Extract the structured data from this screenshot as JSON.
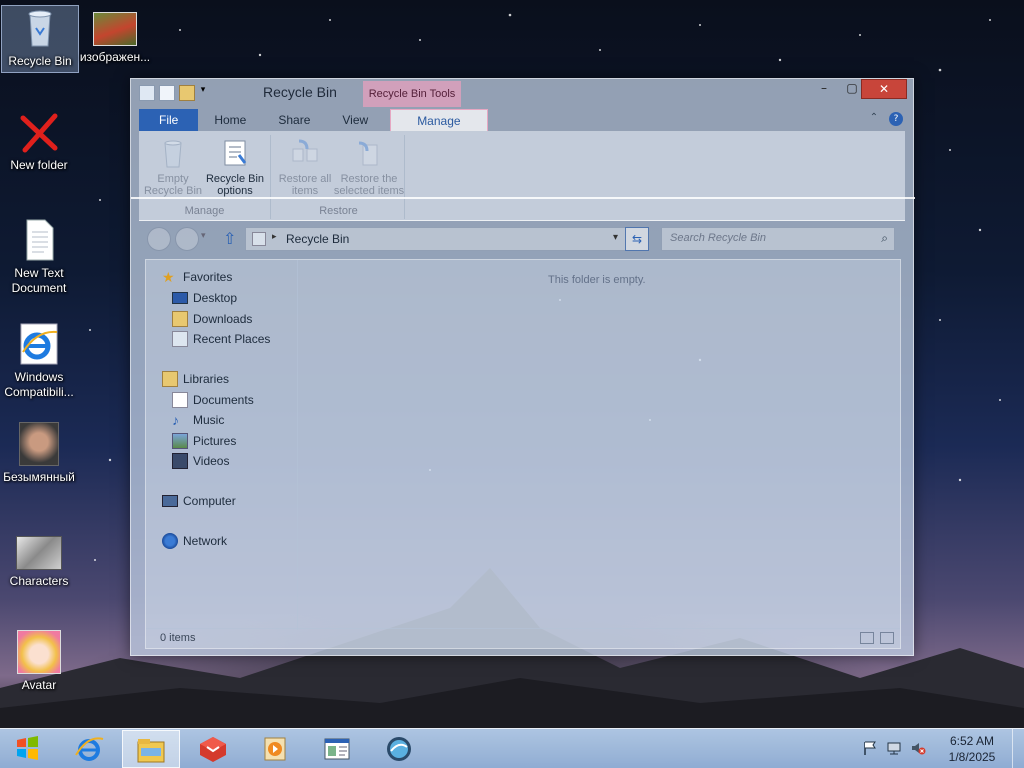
{
  "desktop": {
    "icons": [
      {
        "label": "Recycle Bin",
        "icon": "recycle-bin-icon"
      },
      {
        "label": "изображен...",
        "icon": "image-thumbnail-icon"
      },
      {
        "label": "New folder",
        "icon": "red-x-icon"
      },
      {
        "label": "New Text Document",
        "icon": "text-document-icon"
      },
      {
        "label": "Windows Compatibili...",
        "icon": "internet-explorer-icon"
      },
      {
        "label": "Безымянный",
        "icon": "photo-thumbnail-icon"
      },
      {
        "label": "Characters",
        "icon": "characters-image-icon"
      },
      {
        "label": "Avatar",
        "icon": "avatar-image-icon"
      }
    ]
  },
  "window": {
    "title": "Recycle Bin",
    "contextual_tab_header": "Recycle Bin Tools",
    "tabs": [
      "File",
      "Home",
      "Share",
      "View",
      "Manage"
    ],
    "ribbon": {
      "groups": [
        {
          "label": "Manage",
          "buttons": [
            "Empty Recycle Bin",
            "Recycle Bin options"
          ]
        },
        {
          "label": "Restore",
          "buttons": [
            "Restore all items",
            "Restore the selected items"
          ]
        }
      ]
    },
    "address": {
      "path": "Recycle Bin"
    },
    "search": {
      "placeholder": "Search Recycle Bin"
    },
    "nav": {
      "favorites": "Favorites",
      "desktop": "Desktop",
      "downloads": "Downloads",
      "recent_places": "Recent Places",
      "libraries": "Libraries",
      "documents": "Documents",
      "music": "Music",
      "pictures": "Pictures",
      "videos": "Videos",
      "computer": "Computer",
      "network": "Network"
    },
    "empty_message": "This folder is empty.",
    "status": "0 items"
  },
  "taskbar": {
    "items": [
      "internet-explorer-icon",
      "file-explorer-icon",
      "red-cube-app-icon",
      "media-player-icon",
      "window-app-icon",
      "globe-app-icon"
    ],
    "clock": {
      "time": "6:52 AM",
      "date": "1/8/2025"
    }
  }
}
